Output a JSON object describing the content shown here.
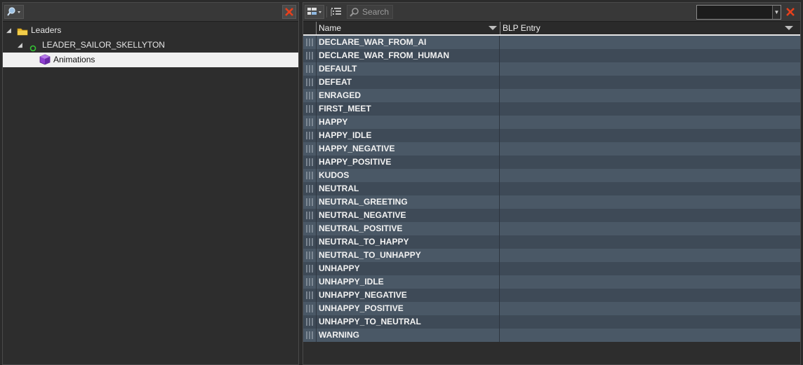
{
  "left": {
    "tree": [
      {
        "label": "Leaders",
        "icon": "folder-icon",
        "expanded": true,
        "level": 0
      },
      {
        "label": "LEADER_SAILOR_SKELLYTON",
        "icon": "status-dot-icon",
        "expanded": true,
        "level": 1
      },
      {
        "label": "Animations",
        "icon": "cube-icon",
        "level": 2,
        "selected": true
      }
    ]
  },
  "right": {
    "toolbar": {
      "search_label": "Search",
      "filter_value": ""
    },
    "columns": [
      "Name",
      "BLP Entry"
    ],
    "rows": [
      "DECLARE_WAR_FROM_AI",
      "DECLARE_WAR_FROM_HUMAN",
      "DEFAULT",
      "DEFEAT",
      "ENRAGED",
      "FIRST_MEET",
      "HAPPY",
      "HAPPY_IDLE",
      "HAPPY_NEGATIVE",
      "HAPPY_POSITIVE",
      "KUDOS",
      "NEUTRAL",
      "NEUTRAL_GREETING",
      "NEUTRAL_NEGATIVE",
      "NEUTRAL_POSITIVE",
      "NEUTRAL_TO_HAPPY",
      "NEUTRAL_TO_UNHAPPY",
      "UNHAPPY",
      "UNHAPPY_IDLE",
      "UNHAPPY_NEGATIVE",
      "UNHAPPY_POSITIVE",
      "UNHAPPY_TO_NEUTRAL",
      "WARNING"
    ]
  },
  "colors": {
    "row_even": "#4a5866",
    "row_odd": "#3e4a57",
    "close_red": "#e8401c",
    "selection": "#f0f0f0"
  }
}
